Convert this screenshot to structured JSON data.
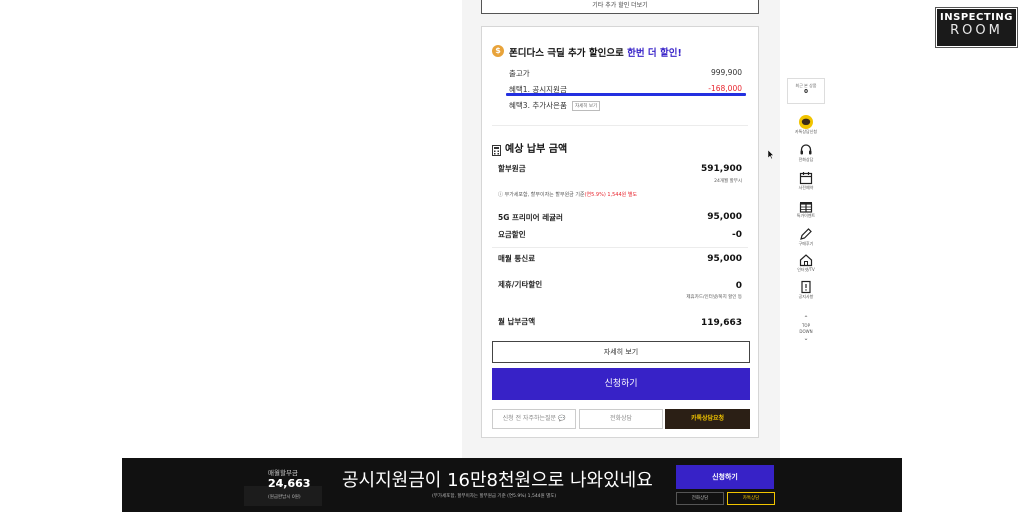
{
  "top_button_label": "기타 추가 할인 더보기",
  "promo": {
    "coin_symbol": "$",
    "title_main": "폰디다스 극딜 추가 할인으로 ",
    "title_highlight": "한번 더 할인!",
    "rows": [
      {
        "label": "출고가",
        "value": "999,900"
      },
      {
        "label": "혜택1. 공시지원금",
        "value": "-168,000"
      },
      {
        "label": "혜택3. 추가사은품",
        "tag": "자세히 보기"
      }
    ]
  },
  "estimate": {
    "title": "예상 납부 금액",
    "installment_label": "할부원금",
    "installment_value": "591,900",
    "installment_sub": "24개월 할부시",
    "installment_note": "부가세포함, 할부이자는 할부원금 기준",
    "installment_note_red": "(연5.9%) 1,544원 별도",
    "plan_label": "5G 프리미어 레귤러",
    "plan_value": "95,000",
    "discount_label": "요금할인",
    "discount_value": "-0",
    "monthly_fee_label": "매월 통신료",
    "monthly_fee_value": "95,000",
    "partner_label": "제휴/기타할인",
    "partner_value": "0",
    "partner_sub": "제휴카드/인터넷/복지 할인 등",
    "monthly_total_label": "월 납부금액",
    "monthly_total_value": "119,663"
  },
  "buttons": {
    "detail": "자세히 보기",
    "apply": "신청하기",
    "qna": "신청 전 자주하는질문 💬",
    "phone": "전화상담",
    "kakao": "카톡상담요청"
  },
  "sidebar": {
    "recent_label": "최근 본 상품",
    "recent_count": "0",
    "items": [
      {
        "label": "카톡상담신청",
        "icon": "kakao-talk-icon"
      },
      {
        "label": "전화상담",
        "icon": "headset-icon"
      },
      {
        "label": "사전예약",
        "icon": "calendar-icon"
      },
      {
        "label": "특가이벤트",
        "icon": "gift-icon"
      },
      {
        "label": "구매후기",
        "icon": "pencil-icon"
      },
      {
        "label": "인터넷/TV",
        "icon": "home-wifi-icon"
      },
      {
        "label": "공지사항",
        "icon": "notice-icon"
      }
    ],
    "top_label": "TOP",
    "down_label": "DOWN"
  },
  "brand": {
    "line1": "INSPECTING",
    "line2": "ROOM"
  },
  "bottom_bar": {
    "label": "매월할부금",
    "value": "24,663",
    "sub": "(원금완납시 0원)",
    "caption": "공시지원금이 16만8천원으로 나와있네요",
    "apply": "신청하기",
    "note": "(부가세포함, 할부이자는 할부원금 기준 (연5.9%) 1,544원 별도)",
    "phone": "전화상담",
    "kakao": "카톡상담"
  },
  "colors": {
    "accent": "#3722c7",
    "highlight_line": "#2330e0",
    "red": "#e8262f",
    "kakao_yellow": "#f1c400"
  }
}
